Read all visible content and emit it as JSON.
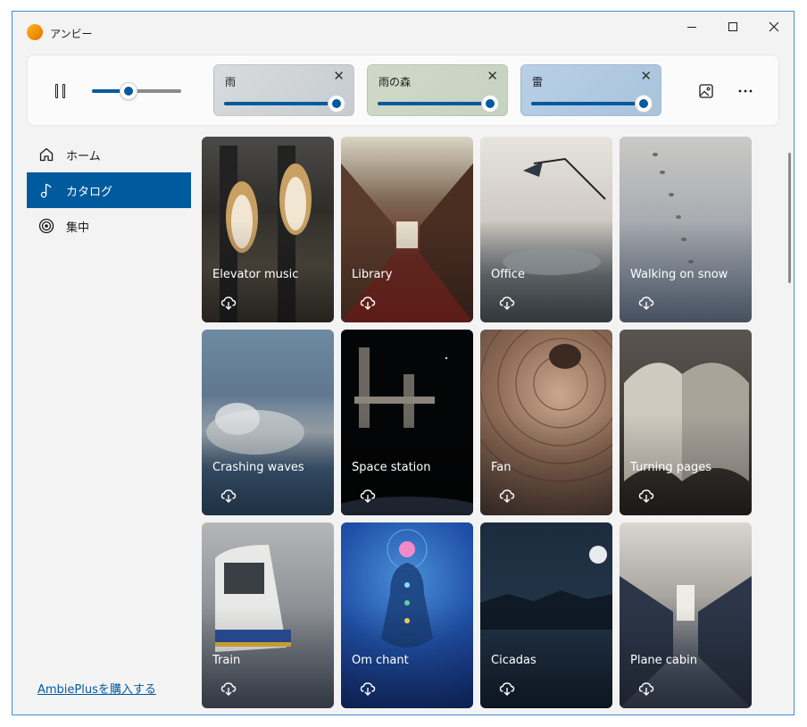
{
  "window": {
    "title": "アンビー"
  },
  "player": {
    "volume_percent": 41,
    "mixers": [
      {
        "label": "雨",
        "level_percent": 100
      },
      {
        "label": "雨の森",
        "level_percent": 100
      },
      {
        "label": "雷",
        "level_percent": 100
      }
    ]
  },
  "sidebar": {
    "items": [
      {
        "label": "ホーム",
        "icon": "home-icon"
      },
      {
        "label": "カタログ",
        "icon": "music-note-icon",
        "selected": true
      },
      {
        "label": "集中",
        "icon": "target-icon"
      }
    ],
    "buy_link": "AmbiePlusを購入する"
  },
  "catalog": {
    "cards": [
      {
        "name": "Elevator music"
      },
      {
        "name": "Library"
      },
      {
        "name": "Office"
      },
      {
        "name": "Walking on snow"
      },
      {
        "name": "Crashing waves"
      },
      {
        "name": "Space station"
      },
      {
        "name": "Fan"
      },
      {
        "name": "Turning pages"
      },
      {
        "name": "Train"
      },
      {
        "name": "Om chant"
      },
      {
        "name": "Cicadas"
      },
      {
        "name": "Plane cabin"
      }
    ]
  },
  "colors": {
    "accent": "#005a9e",
    "window_border": "#3f8fd8",
    "background": "#f3f3f3"
  }
}
